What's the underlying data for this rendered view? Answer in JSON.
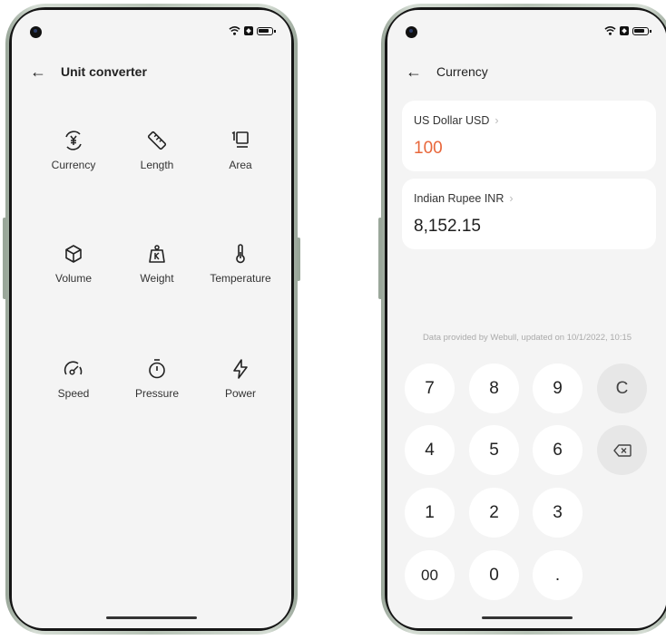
{
  "left_screen": {
    "title": "Unit converter",
    "items": [
      {
        "label": "Currency",
        "icon": "currency-icon"
      },
      {
        "label": "Length",
        "icon": "ruler-icon"
      },
      {
        "label": "Area",
        "icon": "area-icon"
      },
      {
        "label": "Volume",
        "icon": "cube-icon"
      },
      {
        "label": "Weight",
        "icon": "weight-icon"
      },
      {
        "label": "Temperature",
        "icon": "thermometer-icon"
      },
      {
        "label": "Speed",
        "icon": "speedometer-icon"
      },
      {
        "label": "Pressure",
        "icon": "stopwatch-icon"
      },
      {
        "label": "Power",
        "icon": "lightning-icon"
      }
    ]
  },
  "right_screen": {
    "title": "Currency",
    "from": {
      "name": "US Dollar USD",
      "value": "100"
    },
    "to": {
      "name": "Indian Rupee INR",
      "value": "8,152.15"
    },
    "provider": "Data provided by Webull, updated on 10/1/2022, 10:15",
    "keys": {
      "k7": "7",
      "k8": "8",
      "k9": "9",
      "clear": "C",
      "k4": "4",
      "k5": "5",
      "k6": "6",
      "k1": "1",
      "k2": "2",
      "k3": "3",
      "k00": "00",
      "k0": "0",
      "dot": "."
    }
  },
  "colors": {
    "accent": "#e8673b",
    "screen_bg": "#f4f4f4"
  }
}
